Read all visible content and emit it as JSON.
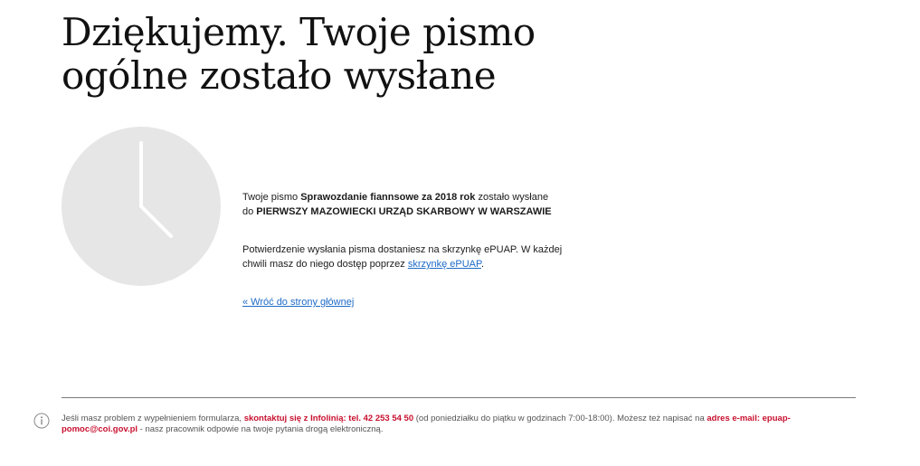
{
  "page": {
    "title": "Dziękujemy. Twoje pismo ogólne zostało wysłane"
  },
  "clock": {
    "icon": "clock-icon",
    "face_color": "#e6e6e6",
    "hand_color": "#ffffff"
  },
  "message": {
    "line1_prefix": "Twoje pismo ",
    "document_name": "Sprawozdanie fiannsowe za 2018 rok",
    "line1_suffix": " zostało wysłane",
    "line2_prefix": "do ",
    "recipient": "PIERWSZY MAZOWIECKI URZĄD SKARBOWY W WARSZAWIE",
    "confirmation_prefix": "Potwierdzenie wysłania pisma dostaniesz na skrzynkę ePUAP. W każdej chwili masz do niego dostęp poprzez ",
    "epuap_link": "skrzynkę ePUAP",
    "confirmation_suffix": ".",
    "back_link": "« Wróć do strony głównej"
  },
  "footer": {
    "icon": "info-icon",
    "text1": "Jeśli masz problem z wypełnieniem formularza, ",
    "contact": "skontaktuj się z Infolinią: tel. 42 253 54 50",
    "text2": " (od poniedziałku do piątku w godzinach 7:00-18:00). Możesz też napisać na ",
    "email": "adres e-mail: epuap-pomoc@coi.gov.pl",
    "text3": " - nasz pracownik odpowie na twoje pytania drogą elektroniczną.",
    "accent_color": "#c8102e"
  },
  "colors": {
    "link": "#1e6bc7",
    "divider": "#7a7a7a"
  }
}
